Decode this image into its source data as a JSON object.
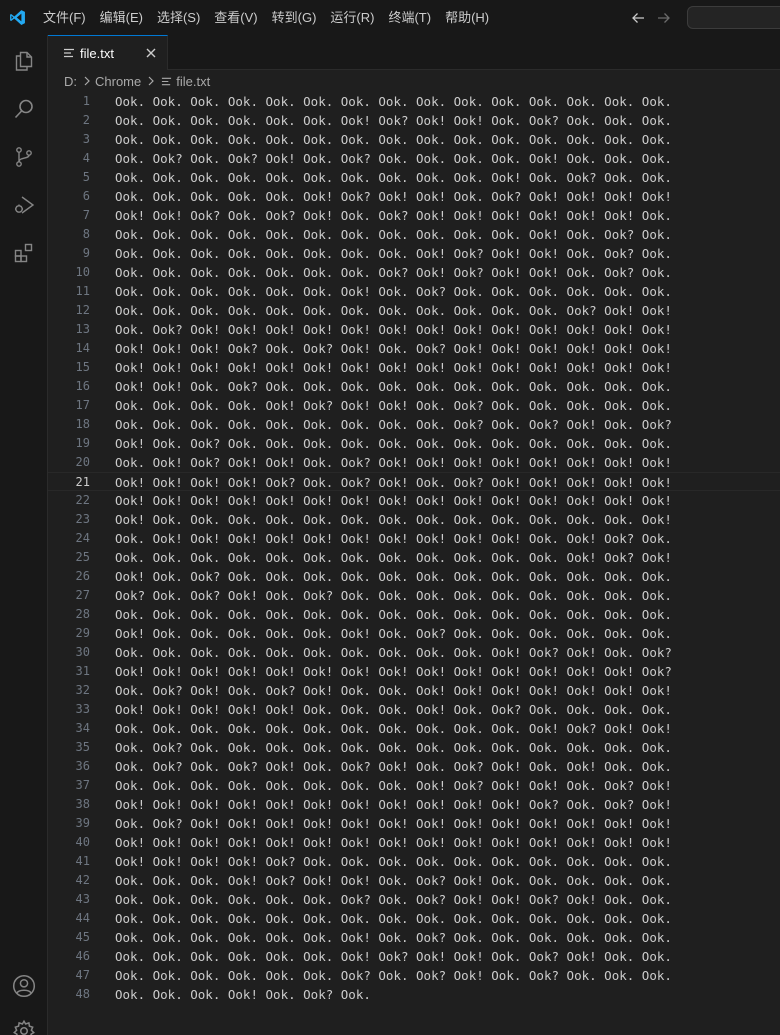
{
  "menu": [
    "文件(F)",
    "编辑(E)",
    "选择(S)",
    "查看(V)",
    "转到(G)",
    "运行(R)",
    "终端(T)",
    "帮助(H)"
  ],
  "icons": {
    "app": "vscode-logo-icon",
    "back": "arrow-left-icon",
    "forward": "arrow-right-icon",
    "explorer": "files-icon",
    "search": "search-icon",
    "scm": "source-control-icon",
    "debug": "run-debug-icon",
    "extensions": "extensions-icon",
    "account": "account-icon",
    "settings": "gear-icon",
    "file": "text-file-icon",
    "close": "close-icon"
  },
  "colors": {
    "accent": "#0078d4",
    "logo": "#23a9f2"
  },
  "tab": {
    "label": "file.txt"
  },
  "breadcrumb": {
    "drive": "D:",
    "folder": "Chrome",
    "file": "file.txt"
  },
  "editor": {
    "current_line": 21,
    "lines": [
      "Ook. Ook. Ook. Ook. Ook. Ook. Ook. Ook. Ook. Ook. Ook. Ook. Ook. Ook. Ook.",
      "Ook. Ook. Ook. Ook. Ook. Ook. Ook! Ook? Ook! Ook! Ook. Ook? Ook. Ook. Ook.",
      "Ook. Ook. Ook. Ook. Ook. Ook. Ook. Ook. Ook. Ook. Ook. Ook. Ook. Ook. Ook.",
      "Ook. Ook? Ook. Ook? Ook! Ook. Ook? Ook. Ook. Ook. Ook. Ook! Ook. Ook. Ook.",
      "Ook. Ook. Ook. Ook. Ook. Ook. Ook. Ook. Ook. Ook. Ook! Ook. Ook? Ook. Ook.",
      "Ook. Ook. Ook. Ook. Ook. Ook! Ook? Ook! Ook! Ook. Ook? Ook! Ook! Ook! Ook!",
      "Ook! Ook! Ook? Ook. Ook? Ook! Ook. Ook? Ook! Ook! Ook! Ook! Ook! Ook! Ook.",
      "Ook. Ook. Ook. Ook. Ook. Ook. Ook. Ook. Ook. Ook. Ook. Ook! Ook. Ook? Ook.",
      "Ook. Ook. Ook. Ook. Ook. Ook. Ook. Ook. Ook! Ook? Ook! Ook! Ook. Ook? Ook.",
      "Ook. Ook. Ook. Ook. Ook. Ook. Ook. Ook? Ook! Ook? Ook! Ook! Ook. Ook? Ook.",
      "Ook. Ook. Ook. Ook. Ook. Ook. Ook! Ook. Ook? Ook. Ook. Ook. Ook. Ook. Ook.",
      "Ook. Ook. Ook. Ook. Ook. Ook. Ook. Ook. Ook. Ook. Ook. Ook. Ook? Ook! Ook!",
      "Ook. Ook? Ook! Ook! Ook! Ook! Ook! Ook! Ook! Ook! Ook! Ook! Ook! Ook! Ook!",
      "Ook! Ook! Ook! Ook? Ook. Ook? Ook! Ook. Ook? Ook! Ook! Ook! Ook! Ook! Ook!",
      "Ook! Ook! Ook! Ook! Ook! Ook! Ook! Ook! Ook! Ook! Ook! Ook! Ook! Ook! Ook!",
      "Ook! Ook! Ook. Ook? Ook. Ook. Ook. Ook. Ook. Ook. Ook. Ook. Ook. Ook. Ook.",
      "Ook. Ook. Ook. Ook. Ook! Ook? Ook! Ook! Ook. Ook? Ook. Ook. Ook. Ook. Ook.",
      "Ook. Ook. Ook. Ook. Ook. Ook. Ook. Ook. Ook. Ook? Ook. Ook? Ook! Ook. Ook?",
      "Ook! Ook. Ook? Ook. Ook. Ook. Ook. Ook. Ook. Ook. Ook. Ook. Ook. Ook. Ook.",
      "Ook. Ook! Ook? Ook! Ook! Ook. Ook? Ook! Ook! Ook! Ook! Ook! Ook! Ook! Ook!",
      "Ook! Ook! Ook! Ook! Ook? Ook. Ook? Ook! Ook. Ook? Ook! Ook! Ook! Ook! Ook!",
      "Ook! Ook! Ook! Ook! Ook! Ook! Ook! Ook! Ook! Ook! Ook! Ook! Ook! Ook! Ook!",
      "Ook! Ook. Ook. Ook. Ook. Ook. Ook. Ook. Ook. Ook. Ook. Ook. Ook. Ook. Ook!",
      "Ook. Ook! Ook! Ook! Ook! Ook! Ook! Ook! Ook! Ook! Ook! Ook. Ook! Ook? Ook.",
      "Ook. Ook. Ook. Ook. Ook. Ook. Ook. Ook. Ook. Ook. Ook. Ook. Ook! Ook? Ook!",
      "Ook! Ook. Ook? Ook. Ook. Ook. Ook. Ook. Ook. Ook. Ook. Ook. Ook. Ook. Ook.",
      "Ook? Ook. Ook? Ook! Ook. Ook? Ook. Ook. Ook. Ook. Ook. Ook. Ook. Ook. Ook.",
      "Ook. Ook. Ook. Ook. Ook. Ook. Ook. Ook. Ook. Ook. Ook. Ook. Ook. Ook. Ook.",
      "Ook! Ook. Ook. Ook. Ook. Ook. Ook! Ook. Ook? Ook. Ook. Ook. Ook. Ook. Ook.",
      "Ook. Ook. Ook. Ook. Ook. Ook. Ook. Ook. Ook. Ook. Ook! Ook? Ook! Ook. Ook?",
      "Ook! Ook! Ook! Ook! Ook! Ook! Ook! Ook! Ook! Ook! Ook! Ook! Ook! Ook! Ook?",
      "Ook. Ook? Ook! Ook. Ook? Ook! Ook. Ook. Ook! Ook! Ook! Ook! Ook! Ook! Ook!",
      "Ook! Ook! Ook! Ook! Ook! Ook. Ook. Ook. Ook! Ook. Ook? Ook. Ook. Ook. Ook.",
      "Ook. Ook. Ook. Ook. Ook. Ook. Ook. Ook. Ook. Ook. Ook. Ook! Ook? Ook! Ook!",
      "Ook. Ook? Ook. Ook. Ook. Ook. Ook. Ook. Ook. Ook. Ook. Ook. Ook. Ook. Ook.",
      "Ook. Ook? Ook. Ook? Ook! Ook. Ook? Ook! Ook. Ook? Ook! Ook. Ook! Ook. Ook.",
      "Ook. Ook. Ook. Ook. Ook. Ook. Ook. Ook. Ook! Ook? Ook! Ook! Ook. Ook? Ook!",
      "Ook! Ook! Ook! Ook! Ook! Ook! Ook! Ook! Ook! Ook! Ook! Ook? Ook. Ook? Ook!",
      "Ook. Ook? Ook! Ook! Ook! Ook! Ook! Ook! Ook! Ook! Ook! Ook! Ook! Ook! Ook!",
      "Ook! Ook! Ook! Ook! Ook! Ook! Ook! Ook! Ook! Ook! Ook! Ook! Ook! Ook! Ook!",
      "Ook! Ook! Ook! Ook! Ook? Ook. Ook. Ook. Ook. Ook. Ook. Ook. Ook. Ook. Ook.",
      "Ook. Ook. Ook. Ook! Ook? Ook! Ook! Ook. Ook? Ook! Ook. Ook. Ook. Ook. Ook.",
      "Ook. Ook. Ook. Ook. Ook. Ook. Ook? Ook. Ook? Ook! Ook! Ook? Ook! Ook. Ook.",
      "Ook. Ook. Ook. Ook. Ook. Ook. Ook. Ook. Ook. Ook. Ook. Ook. Ook. Ook. Ook.",
      "Ook. Ook. Ook. Ook. Ook. Ook. Ook! Ook. Ook? Ook. Ook. Ook. Ook. Ook. Ook.",
      "Ook. Ook. Ook. Ook. Ook. Ook. Ook! Ook? Ook! Ook! Ook. Ook? Ook! Ook. Ook.",
      "Ook. Ook. Ook. Ook. Ook. Ook. Ook? Ook. Ook? Ook! Ook. Ook? Ook. Ook. Ook.",
      "Ook. Ook. Ook. Ook! Ook. Ook? Ook."
    ]
  }
}
